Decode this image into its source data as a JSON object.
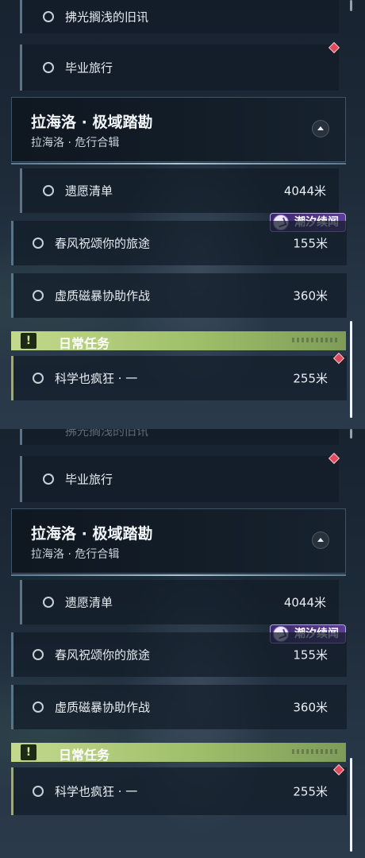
{
  "top": {
    "quest_prev": "拂光搁浅的旧讯",
    "quest_graduation": "毕业旅行",
    "chapter_title": "拉海洛 · 极域踏勘",
    "chapter_subtitle": "拉海洛 · 危行合辑",
    "quests": [
      {
        "label": "遗愿清单",
        "distance": "4044米"
      },
      {
        "label": "春风祝颂你的旅途",
        "distance": "155米"
      },
      {
        "label": "虚质磁暴协助作战",
        "distance": "360米"
      }
    ],
    "badge": "潮汐续闻",
    "daily_title": "日常任务",
    "daily_quest": {
      "label": "科学也疯狂 · 一",
      "distance": "255米"
    }
  },
  "bottom": {
    "quest_prev": "拂光搁浅的旧讯",
    "quest_graduation": "毕业旅行",
    "chapter_title": "拉海洛 · 极域踏勘",
    "chapter_subtitle": "拉海洛 · 危行合辑",
    "quests": [
      {
        "label": "遗愿清单",
        "distance": "4044米"
      },
      {
        "label": "春风祝颂你的旅途",
        "distance": "155米"
      },
      {
        "label": "虚质磁暴协助作战",
        "distance": "360米"
      }
    ],
    "badge": "潮汐续闻",
    "daily_title": "日常任务",
    "daily_quest": {
      "label": "科学也疯狂 · 一",
      "distance": "255米"
    }
  },
  "colors": {
    "accent_purple": "#5c3e98",
    "daily_green": "#c3d98c",
    "marker_red": "#e04a5c"
  },
  "icons": [
    "quest-circle-icon",
    "red-diamond-marker-icon",
    "collapse-arrow-icon",
    "tide-badge-icon",
    "exclamation-icon"
  ]
}
